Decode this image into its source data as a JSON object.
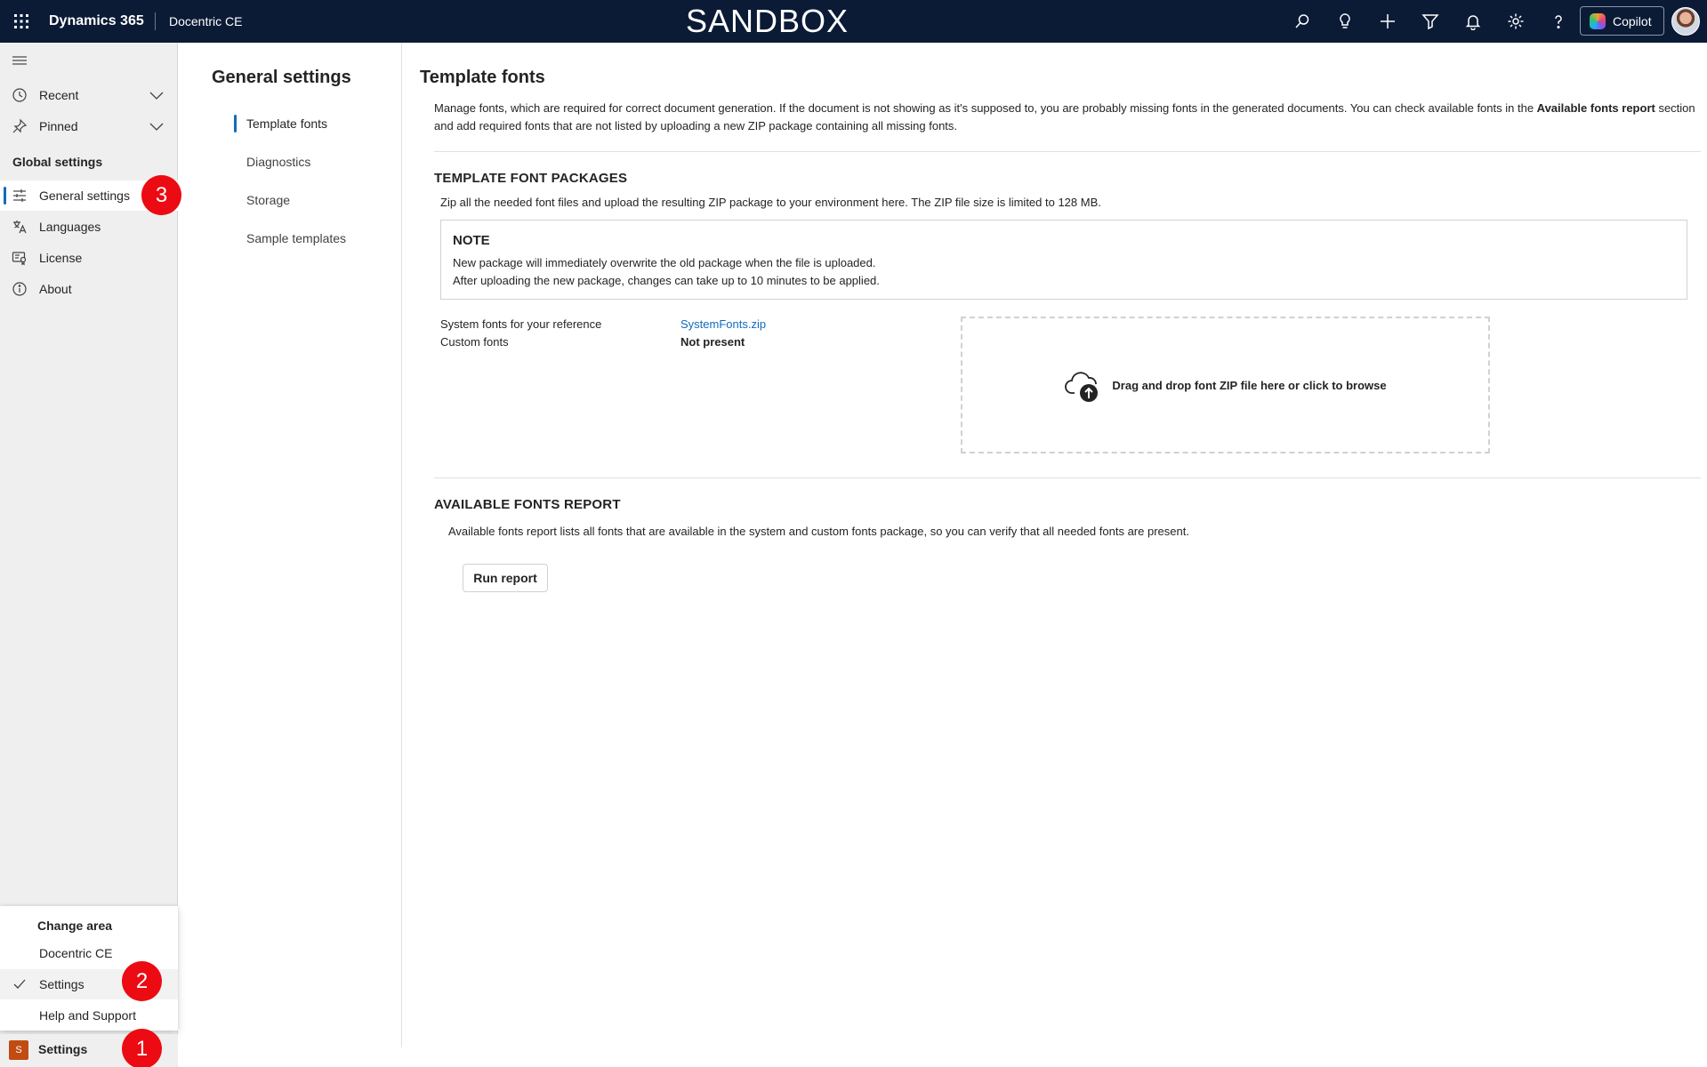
{
  "topbar": {
    "brand": "Dynamics 365",
    "app_name": "Docentric CE",
    "environment_banner": "SANDBOX",
    "icons": [
      "search-icon",
      "lightbulb-icon",
      "add-icon",
      "filter-icon",
      "bell-icon",
      "gear-icon",
      "help-icon"
    ],
    "copilot_label": "Copilot"
  },
  "sitemap": {
    "recent": "Recent",
    "pinned": "Pinned",
    "group_title": "Global settings",
    "items": [
      {
        "label": "General settings",
        "icon": "sliders-icon",
        "selected": true
      },
      {
        "label": "Languages",
        "icon": "translate-icon",
        "selected": false
      },
      {
        "label": "License",
        "icon": "license-icon",
        "selected": false
      },
      {
        "label": "About",
        "icon": "info-icon",
        "selected": false
      }
    ]
  },
  "area_popup": {
    "title": "Change area",
    "options": [
      {
        "label": "Docentric CE",
        "selected": false
      },
      {
        "label": "Settings",
        "selected": true
      },
      {
        "label": "Help and Support",
        "selected": false
      }
    ]
  },
  "area_switcher": {
    "badge": "S",
    "label": "Settings"
  },
  "markers": {
    "one": "1",
    "two": "2",
    "three": "3"
  },
  "settings_nav": {
    "heading": "General settings",
    "items": [
      {
        "label": "Template fonts",
        "active": true
      },
      {
        "label": "Diagnostics",
        "active": false
      },
      {
        "label": "Storage",
        "active": false
      },
      {
        "label": "Sample templates",
        "active": false
      }
    ]
  },
  "content": {
    "title": "Template fonts",
    "intro_part1": "Manage fonts, which are required for correct document generation. If the document is not showing as it's supposed to, you are probably missing fonts in the generated documents. You can check available fonts in the ",
    "intro_bold": "Available fonts report",
    "intro_part2": " section and add required fonts that are not listed by uploading a new ZIP package containing all missing fonts.",
    "packages": {
      "title": "TEMPLATE FONT PACKAGES",
      "description": "Zip all the needed font files and upload the resulting ZIP package to your environment here. The ZIP file size is limited to 128 MB.",
      "note_title": "NOTE",
      "note_line1": "New package will immediately overwrite the old package when the file is uploaded.",
      "note_line2": "After uploading the new package, changes can take up to 10 minutes to be applied.",
      "system_fonts_label": "System fonts for your reference",
      "system_fonts_value": "SystemFonts.zip",
      "custom_fonts_label": "Custom fonts",
      "custom_fonts_value": "Not present",
      "dropzone_text": "Drag and drop font ZIP file here or click to browse"
    },
    "report": {
      "title": "AVAILABLE FONTS REPORT",
      "description": "Available fonts report lists all fonts that are available in the system and custom fonts package, so you can verify that all needed fonts are present.",
      "button": "Run report"
    }
  },
  "colors": {
    "topbar": "#0b1b36",
    "accent": "#0f6cbd",
    "marker": "#ec0b13",
    "area_badge": "#c04c12"
  }
}
